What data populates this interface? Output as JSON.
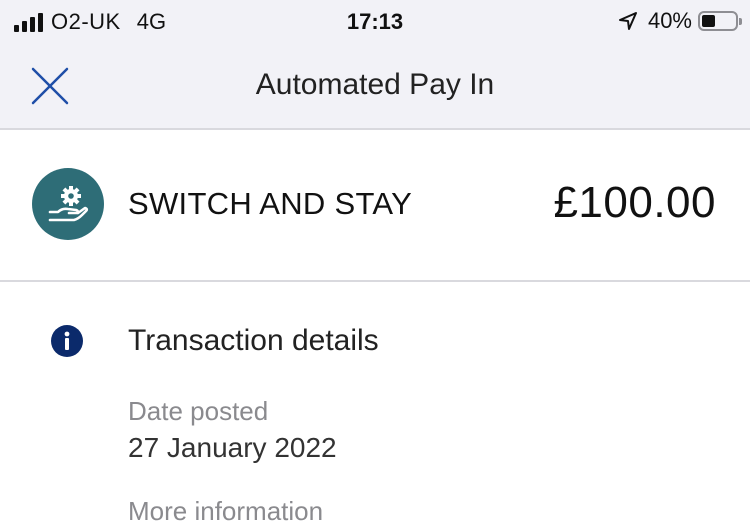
{
  "status_bar": {
    "carrier": "O2-UK",
    "network": "4G",
    "time": "17:13",
    "battery_percent": "40%",
    "battery_level": 0.4,
    "signal_bars": 4
  },
  "nav": {
    "title": "Automated Pay In",
    "close_icon": "close-icon"
  },
  "transaction": {
    "merchant_name": "SWITCH AND STAY",
    "merchant_icon": "hand-gear-icon",
    "amount": "£100.00",
    "avatar_color": "#2e6d77"
  },
  "details": {
    "heading": "Transaction details",
    "info_icon": "info-icon",
    "date_posted_label": "Date posted",
    "date_posted_value": "27 January 2022",
    "more_info_label": "More information"
  },
  "colors": {
    "accent_blue": "#1f4fa8",
    "info_navy": "#0b2a6b",
    "header_bg": "#f2f2f7"
  }
}
